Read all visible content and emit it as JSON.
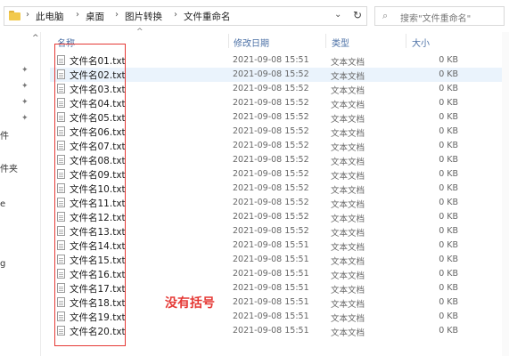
{
  "address_bar": {
    "breadcrumbs": [
      "此电脑",
      "桌面",
      "图片转换",
      "文件重命名"
    ],
    "separator": "›",
    "dropdown_glyph": "⌄",
    "refresh_glyph": "↻"
  },
  "search": {
    "placeholder": "搜索\"文件重命名\"",
    "icon_glyph": "⌕"
  },
  "nav": {
    "up_glyph": "^",
    "pin_glyph": "✦",
    "fragments": [
      "件",
      "件夹",
      "e",
      "",
      "g"
    ]
  },
  "columns": {
    "name": "名称",
    "modified": "修改日期",
    "type": "类型",
    "size": "大小",
    "sort_glyph": "^"
  },
  "files": [
    {
      "name": "文件名01.txt",
      "modified": "2021-09-08 15:51",
      "type": "文本文档",
      "size": "0 KB"
    },
    {
      "name": "文件名02.txt",
      "modified": "2021-09-08 15:52",
      "type": "文本文档",
      "size": "0 KB"
    },
    {
      "name": "文件名03.txt",
      "modified": "2021-09-08 15:52",
      "type": "文本文档",
      "size": "0 KB"
    },
    {
      "name": "文件名04.txt",
      "modified": "2021-09-08 15:52",
      "type": "文本文档",
      "size": "0 KB"
    },
    {
      "name": "文件名05.txt",
      "modified": "2021-09-08 15:52",
      "type": "文本文档",
      "size": "0 KB"
    },
    {
      "name": "文件名06.txt",
      "modified": "2021-09-08 15:52",
      "type": "文本文档",
      "size": "0 KB"
    },
    {
      "name": "文件名07.txt",
      "modified": "2021-09-08 15:52",
      "type": "文本文档",
      "size": "0 KB"
    },
    {
      "name": "文件名08.txt",
      "modified": "2021-09-08 15:52",
      "type": "文本文档",
      "size": "0 KB"
    },
    {
      "name": "文件名09.txt",
      "modified": "2021-09-08 15:52",
      "type": "文本文档",
      "size": "0 KB"
    },
    {
      "name": "文件名10.txt",
      "modified": "2021-09-08 15:52",
      "type": "文本文档",
      "size": "0 KB"
    },
    {
      "name": "文件名11.txt",
      "modified": "2021-09-08 15:52",
      "type": "文本文档",
      "size": "0 KB"
    },
    {
      "name": "文件名12.txt",
      "modified": "2021-09-08 15:52",
      "type": "文本文档",
      "size": "0 KB"
    },
    {
      "name": "文件名13.txt",
      "modified": "2021-09-08 15:52",
      "type": "文本文档",
      "size": "0 KB"
    },
    {
      "name": "文件名14.txt",
      "modified": "2021-09-08 15:51",
      "type": "文本文档",
      "size": "0 KB"
    },
    {
      "name": "文件名15.txt",
      "modified": "2021-09-08 15:51",
      "type": "文本文档",
      "size": "0 KB"
    },
    {
      "name": "文件名16.txt",
      "modified": "2021-09-08 15:51",
      "type": "文本文档",
      "size": "0 KB"
    },
    {
      "name": "文件名17.txt",
      "modified": "2021-09-08 15:51",
      "type": "文本文档",
      "size": "0 KB"
    },
    {
      "name": "文件名18.txt",
      "modified": "2021-09-08 15:51",
      "type": "文本文档",
      "size": "0 KB"
    },
    {
      "name": "文件名19.txt",
      "modified": "2021-09-08 15:51",
      "type": "文本文档",
      "size": "0 KB"
    },
    {
      "name": "文件名20.txt",
      "modified": "2021-09-08 15:51",
      "type": "文本文档",
      "size": "0 KB"
    }
  ],
  "annotation": {
    "text": "没有括号",
    "color": "#e53935"
  },
  "colors": {
    "header_text": "#4a6fa5",
    "selected_row": "#eaf3fc",
    "folder": "#f2c94c"
  }
}
